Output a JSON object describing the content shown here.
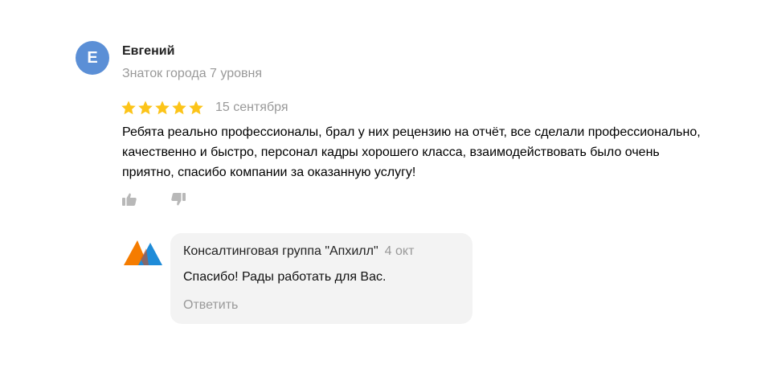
{
  "review": {
    "author": {
      "initial": "Е",
      "name": "Евгений",
      "level": "Знаток города 7 уровня",
      "avatar_color": "#5b8fd6"
    },
    "rating": 5,
    "star_color": "#fcc419",
    "date": "15 сентября",
    "text": "Ребята реально профессионалы, брал у них рецензию на отчёт, все сделали профессионально, качественно и быстро, персонал кадры хорошего класса, взаимодействовать было очень приятно, спасибо компании за оказанную услугу!",
    "actions": {
      "like_icon": "thumbs-up-icon",
      "dislike_icon": "thumbs-down-icon",
      "icon_color": "#b8b8b8"
    }
  },
  "reply": {
    "org_name": "Консалтинговая группа \"Апхилл\"",
    "date": "4 окт",
    "text": "Спасибо! Рады работать для Вас.",
    "action_label": "Ответить",
    "logo": {
      "icon": "apkhill-logo",
      "colors": [
        "#f57c00",
        "#1e8bd8"
      ]
    },
    "bubble_color": "#f3f3f3"
  }
}
